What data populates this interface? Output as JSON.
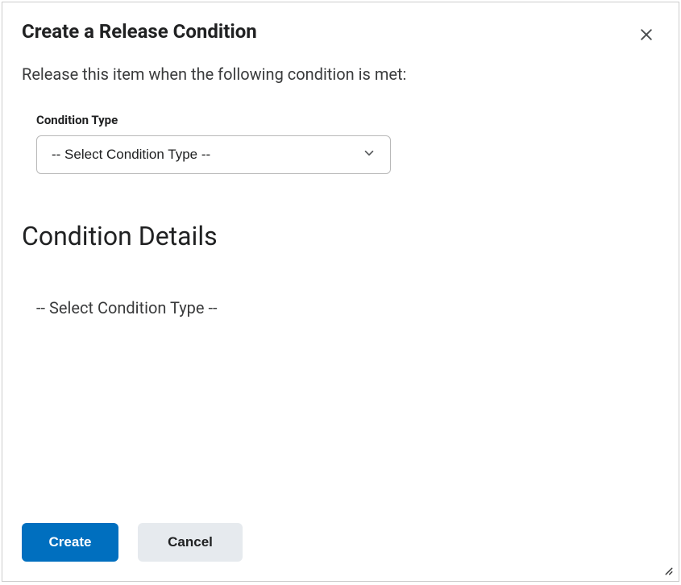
{
  "dialog": {
    "title": "Create a Release Condition",
    "subtitle": "Release this item when the following condition is met:",
    "condition_type": {
      "label": "Condition Type",
      "selected": "-- Select Condition Type --"
    },
    "details": {
      "heading": "Condition Details",
      "placeholder_text": "-- Select Condition Type --"
    },
    "buttons": {
      "create": "Create",
      "cancel": "Cancel"
    }
  }
}
